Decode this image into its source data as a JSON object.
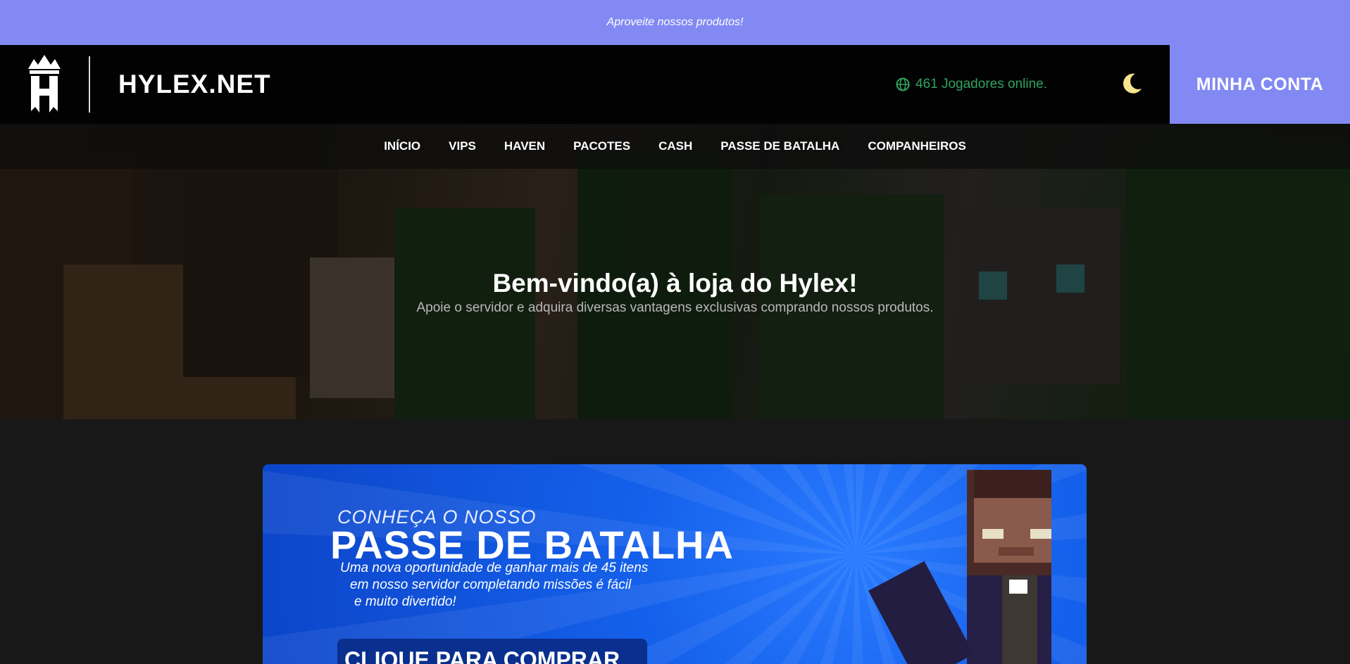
{
  "announcement": {
    "text": "Aproveite nossos produtos!"
  },
  "header": {
    "brand": "HYLEX.NET",
    "online_text": "461 Jogadores online.",
    "account_button": "MINHA CONTA",
    "logo_icon": "crown-h-logo-icon",
    "theme_icon": "moon-icon"
  },
  "nav": {
    "items": [
      {
        "label": "INÍCIO"
      },
      {
        "label": "VIPS"
      },
      {
        "label": "HAVEN"
      },
      {
        "label": "PACOTES"
      },
      {
        "label": "CASH"
      },
      {
        "label": "PASSE DE BATALHA"
      },
      {
        "label": "COMPANHEIROS"
      }
    ]
  },
  "hero": {
    "title": "Bem-vindo(a) à loja do Hylex!",
    "subtitle": "Apoie o servidor e adquira diversas vantagens exclusivas comprando nossos produtos."
  },
  "banner": {
    "pretitle": "CONHEÇA O NOSSO",
    "title": "PASSE DE BATALHA",
    "description_lines": [
      "Uma nova oportunidade de ganhar mais de 45 itens",
      "em nosso servidor completando missões é fácil",
      "e muito divertido!"
    ],
    "button": "CLIQUE PARA COMPRAR"
  },
  "colors": {
    "accent": "#8289f3",
    "online_green": "#2fa35f",
    "moon_yellow": "#f6e58d",
    "banner_blue": "#1561ec"
  }
}
